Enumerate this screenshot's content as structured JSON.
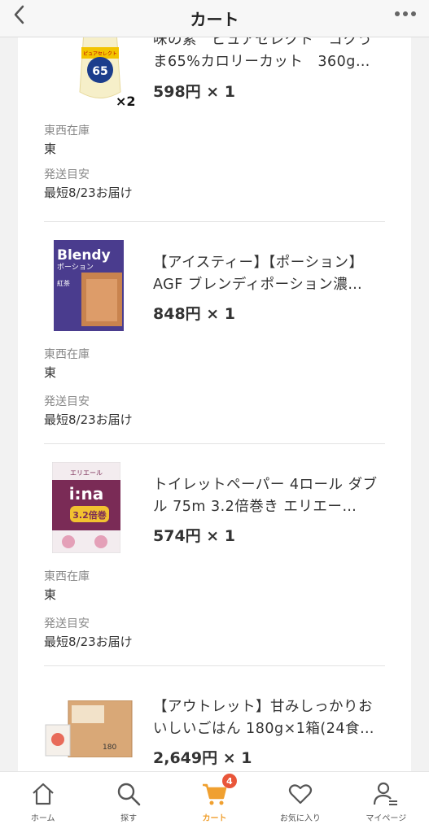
{
  "header": {
    "title": "カート",
    "back_icon": "chevron-left-icon",
    "more_icon": "more-dots-icon"
  },
  "items": [
    {
      "name": "味の素　ピュアセレクト　コクうま65%カロリーカット　360g…",
      "price": "598円 × 1",
      "qty_badge": "×2",
      "stock_label": "東西在庫",
      "stock_value": "東",
      "ship_label": "発送目安",
      "ship_value": "最短8/23お届け",
      "thumb": {
        "big": "65",
        "sub": "ピュアセレクト"
      }
    },
    {
      "name": "【アイスティー】【ポーション】AGF ブレンディポーション濃…",
      "price": "848円 × 1",
      "stock_label": "東西在庫",
      "stock_value": "東",
      "ship_label": "発送目安",
      "ship_value": "最短8/23お届け",
      "thumb": {
        "brand": "Blendy",
        "sub": "ポーション",
        "tag": "紅茶"
      }
    },
    {
      "name": "トイレットペーパー 4ロール ダブル 75m 3.2倍巻き エリエー…",
      "price": "574円 × 1",
      "stock_label": "東西在庫",
      "stock_value": "東",
      "ship_label": "発送目安",
      "ship_value": "最短8/23お届け",
      "thumb": {
        "brand": "エリエール",
        "logo": "i:na",
        "sub": "3.2倍巻"
      }
    },
    {
      "name": "【アウトレット】甘みしっかりおいしいごはん 180g×1箱(24食…",
      "price": "2,649円 × 1",
      "thumb": {
        "code": "180"
      }
    }
  ],
  "tabs": [
    {
      "label": "ホーム",
      "icon": "home-icon"
    },
    {
      "label": "探す",
      "icon": "search-icon"
    },
    {
      "label": "カート",
      "icon": "cart-icon",
      "badge": "4",
      "active": true
    },
    {
      "label": "お気に入り",
      "icon": "heart-icon"
    },
    {
      "label": "マイページ",
      "icon": "user-icon"
    }
  ],
  "colors": {
    "accent": "#f0a030",
    "badge": "#e9563a"
  }
}
